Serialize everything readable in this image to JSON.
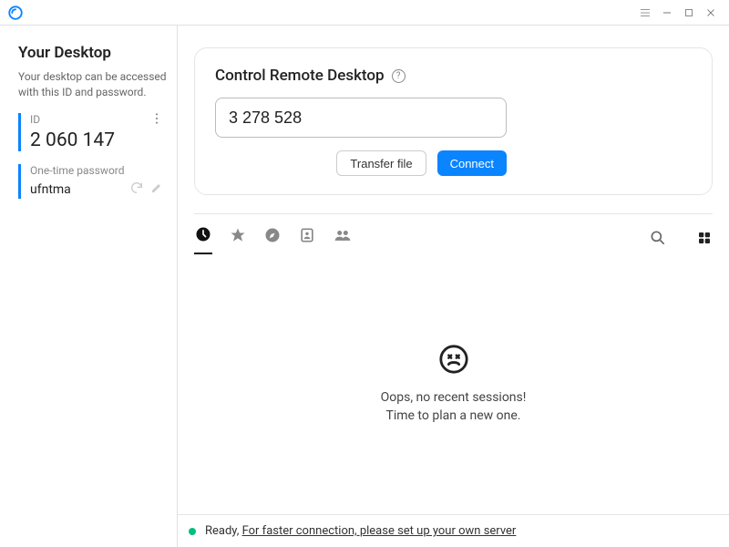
{
  "sidebar": {
    "title": "Your Desktop",
    "description": "Your desktop can be accessed with this ID and password.",
    "id_label": "ID",
    "id_value": "2 060 147",
    "password_label": "One-time password",
    "password_value": "ufntma"
  },
  "control_card": {
    "title": "Control Remote Desktop",
    "input_value": "3 278 528",
    "transfer_label": "Transfer file",
    "connect_label": "Connect"
  },
  "empty": {
    "line1": "Oops, no recent sessions!",
    "line2": "Time to plan a new one."
  },
  "status": {
    "ready": "Ready,",
    "link": "For faster connection, please set up your own server"
  }
}
